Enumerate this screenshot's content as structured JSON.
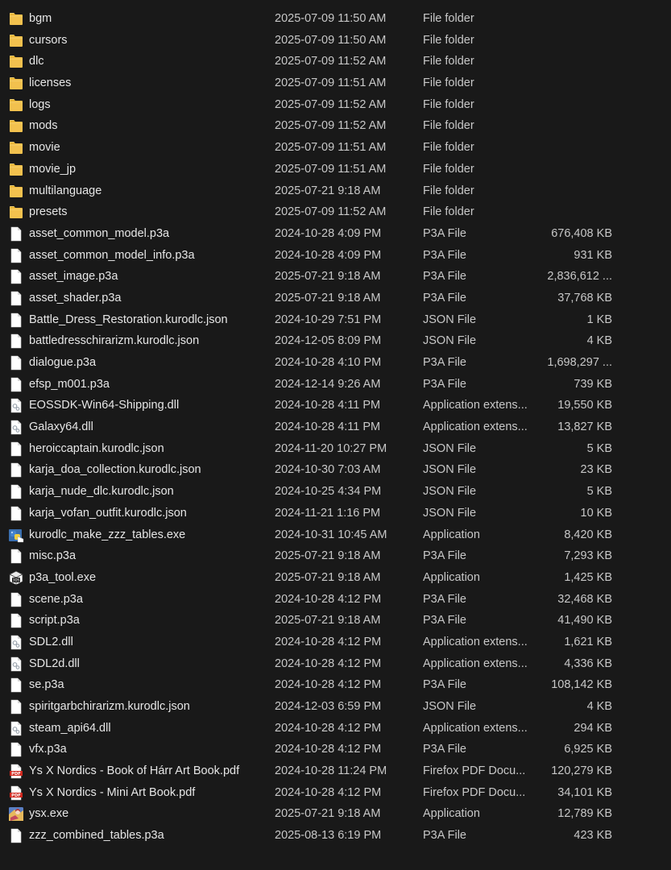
{
  "colors": {
    "background": "#191919",
    "text": "#dcdcdc",
    "folder": "#f2c14e",
    "pdf": "#d0271d"
  },
  "files": [
    {
      "name": "bgm",
      "date": "2025-07-09 11:50 AM",
      "type": "File folder",
      "size": "",
      "icon": "folder-icon"
    },
    {
      "name": "cursors",
      "date": "2025-07-09 11:50 AM",
      "type": "File folder",
      "size": "",
      "icon": "folder-icon"
    },
    {
      "name": "dlc",
      "date": "2025-07-09 11:52 AM",
      "type": "File folder",
      "size": "",
      "icon": "folder-icon"
    },
    {
      "name": "licenses",
      "date": "2025-07-09 11:51 AM",
      "type": "File folder",
      "size": "",
      "icon": "folder-icon"
    },
    {
      "name": "logs",
      "date": "2025-07-09 11:52 AM",
      "type": "File folder",
      "size": "",
      "icon": "folder-icon"
    },
    {
      "name": "mods",
      "date": "2025-07-09 11:52 AM",
      "type": "File folder",
      "size": "",
      "icon": "folder-icon"
    },
    {
      "name": "movie",
      "date": "2025-07-09 11:51 AM",
      "type": "File folder",
      "size": "",
      "icon": "folder-icon"
    },
    {
      "name": "movie_jp",
      "date": "2025-07-09 11:51 AM",
      "type": "File folder",
      "size": "",
      "icon": "folder-icon"
    },
    {
      "name": "multilanguage",
      "date": "2025-07-21 9:18 AM",
      "type": "File folder",
      "size": "",
      "icon": "folder-icon"
    },
    {
      "name": "presets",
      "date": "2025-07-09 11:52 AM",
      "type": "File folder",
      "size": "",
      "icon": "folder-icon"
    },
    {
      "name": "asset_common_model.p3a",
      "date": "2024-10-28 4:09 PM",
      "type": "P3A File",
      "size": "676,408 KB",
      "icon": "file-icon"
    },
    {
      "name": "asset_common_model_info.p3a",
      "date": "2024-10-28 4:09 PM",
      "type": "P3A File",
      "size": "931 KB",
      "icon": "file-icon"
    },
    {
      "name": "asset_image.p3a",
      "date": "2025-07-21 9:18 AM",
      "type": "P3A File",
      "size": "2,836,612 ...",
      "icon": "file-icon"
    },
    {
      "name": "asset_shader.p3a",
      "date": "2025-07-21 9:18 AM",
      "type": "P3A File",
      "size": "37,768 KB",
      "icon": "file-icon"
    },
    {
      "name": "Battle_Dress_Restoration.kurodlc.json",
      "date": "2024-10-29 7:51 PM",
      "type": "JSON File",
      "size": "1 KB",
      "icon": "file-icon"
    },
    {
      "name": "battledresschirarizm.kurodlc.json",
      "date": "2024-12-05 8:09 PM",
      "type": "JSON File",
      "size": "4 KB",
      "icon": "file-icon"
    },
    {
      "name": "dialogue.p3a",
      "date": "2024-10-28 4:10 PM",
      "type": "P3A File",
      "size": "1,698,297 ...",
      "icon": "file-icon"
    },
    {
      "name": "efsp_m001.p3a",
      "date": "2024-12-14 9:26 AM",
      "type": "P3A File",
      "size": "739 KB",
      "icon": "file-icon"
    },
    {
      "name": "EOSSDK-Win64-Shipping.dll",
      "date": "2024-10-28 4:11 PM",
      "type": "Application extens...",
      "size": "19,550 KB",
      "icon": "dll-icon"
    },
    {
      "name": "Galaxy64.dll",
      "date": "2024-10-28 4:11 PM",
      "type": "Application extens...",
      "size": "13,827 KB",
      "icon": "dll-icon"
    },
    {
      "name": "heroiccaptain.kurodlc.json",
      "date": "2024-11-20 10:27 PM",
      "type": "JSON File",
      "size": "5 KB",
      "icon": "file-icon"
    },
    {
      "name": "karja_doa_collection.kurodlc.json",
      "date": "2024-10-30 7:03 AM",
      "type": "JSON File",
      "size": "23 KB",
      "icon": "file-icon"
    },
    {
      "name": "karja_nude_dlc.kurodlc.json",
      "date": "2024-10-25 4:34 PM",
      "type": "JSON File",
      "size": "5 KB",
      "icon": "file-icon"
    },
    {
      "name": "karja_vofan_outfit.kurodlc.json",
      "date": "2024-11-21 1:16 PM",
      "type": "JSON File",
      "size": "10 KB",
      "icon": "file-icon"
    },
    {
      "name": "kurodlc_make_zzz_tables.exe",
      "date": "2024-10-31 10:45 AM",
      "type": "Application",
      "size": "8,420 KB",
      "icon": "python-exe-icon"
    },
    {
      "name": "misc.p3a",
      "date": "2025-07-21 9:18 AM",
      "type": "P3A File",
      "size": "7,293 KB",
      "icon": "file-icon"
    },
    {
      "name": "p3a_tool.exe",
      "date": "2025-07-21 9:18 AM",
      "type": "Application",
      "size": "1,425 KB",
      "icon": "exe-icon"
    },
    {
      "name": "scene.p3a",
      "date": "2024-10-28 4:12 PM",
      "type": "P3A File",
      "size": "32,468 KB",
      "icon": "file-icon"
    },
    {
      "name": "script.p3a",
      "date": "2025-07-21 9:18 AM",
      "type": "P3A File",
      "size": "41,490 KB",
      "icon": "file-icon"
    },
    {
      "name": "SDL2.dll",
      "date": "2024-10-28 4:12 PM",
      "type": "Application extens...",
      "size": "1,621 KB",
      "icon": "dll-icon"
    },
    {
      "name": "SDL2d.dll",
      "date": "2024-10-28 4:12 PM",
      "type": "Application extens...",
      "size": "4,336 KB",
      "icon": "dll-icon"
    },
    {
      "name": "se.p3a",
      "date": "2024-10-28 4:12 PM",
      "type": "P3A File",
      "size": "108,142 KB",
      "icon": "file-icon"
    },
    {
      "name": "spiritgarbchirarizm.kurodlc.json",
      "date": "2024-12-03 6:59 PM",
      "type": "JSON File",
      "size": "4 KB",
      "icon": "file-icon"
    },
    {
      "name": "steam_api64.dll",
      "date": "2024-10-28 4:12 PM",
      "type": "Application extens...",
      "size": "294 KB",
      "icon": "dll-icon"
    },
    {
      "name": "vfx.p3a",
      "date": "2024-10-28 4:12 PM",
      "type": "P3A File",
      "size": "6,925 KB",
      "icon": "file-icon"
    },
    {
      "name": "Ys X Nordics - Book of Hárr Art Book.pdf",
      "date": "2024-10-28 11:24 PM",
      "type": "Firefox PDF Docu...",
      "size": "120,279 KB",
      "icon": "pdf-icon"
    },
    {
      "name": "Ys X Nordics - Mini Art Book.pdf",
      "date": "2024-10-28 4:12 PM",
      "type": "Firefox PDF Docu...",
      "size": "34,101 KB",
      "icon": "pdf-icon"
    },
    {
      "name": "ysx.exe",
      "date": "2025-07-21 9:18 AM",
      "type": "Application",
      "size": "12,789 KB",
      "icon": "game-exe-icon"
    },
    {
      "name": "zzz_combined_tables.p3a",
      "date": "2025-08-13 6:19 PM",
      "type": "P3A File",
      "size": "423 KB",
      "icon": "file-icon"
    }
  ]
}
